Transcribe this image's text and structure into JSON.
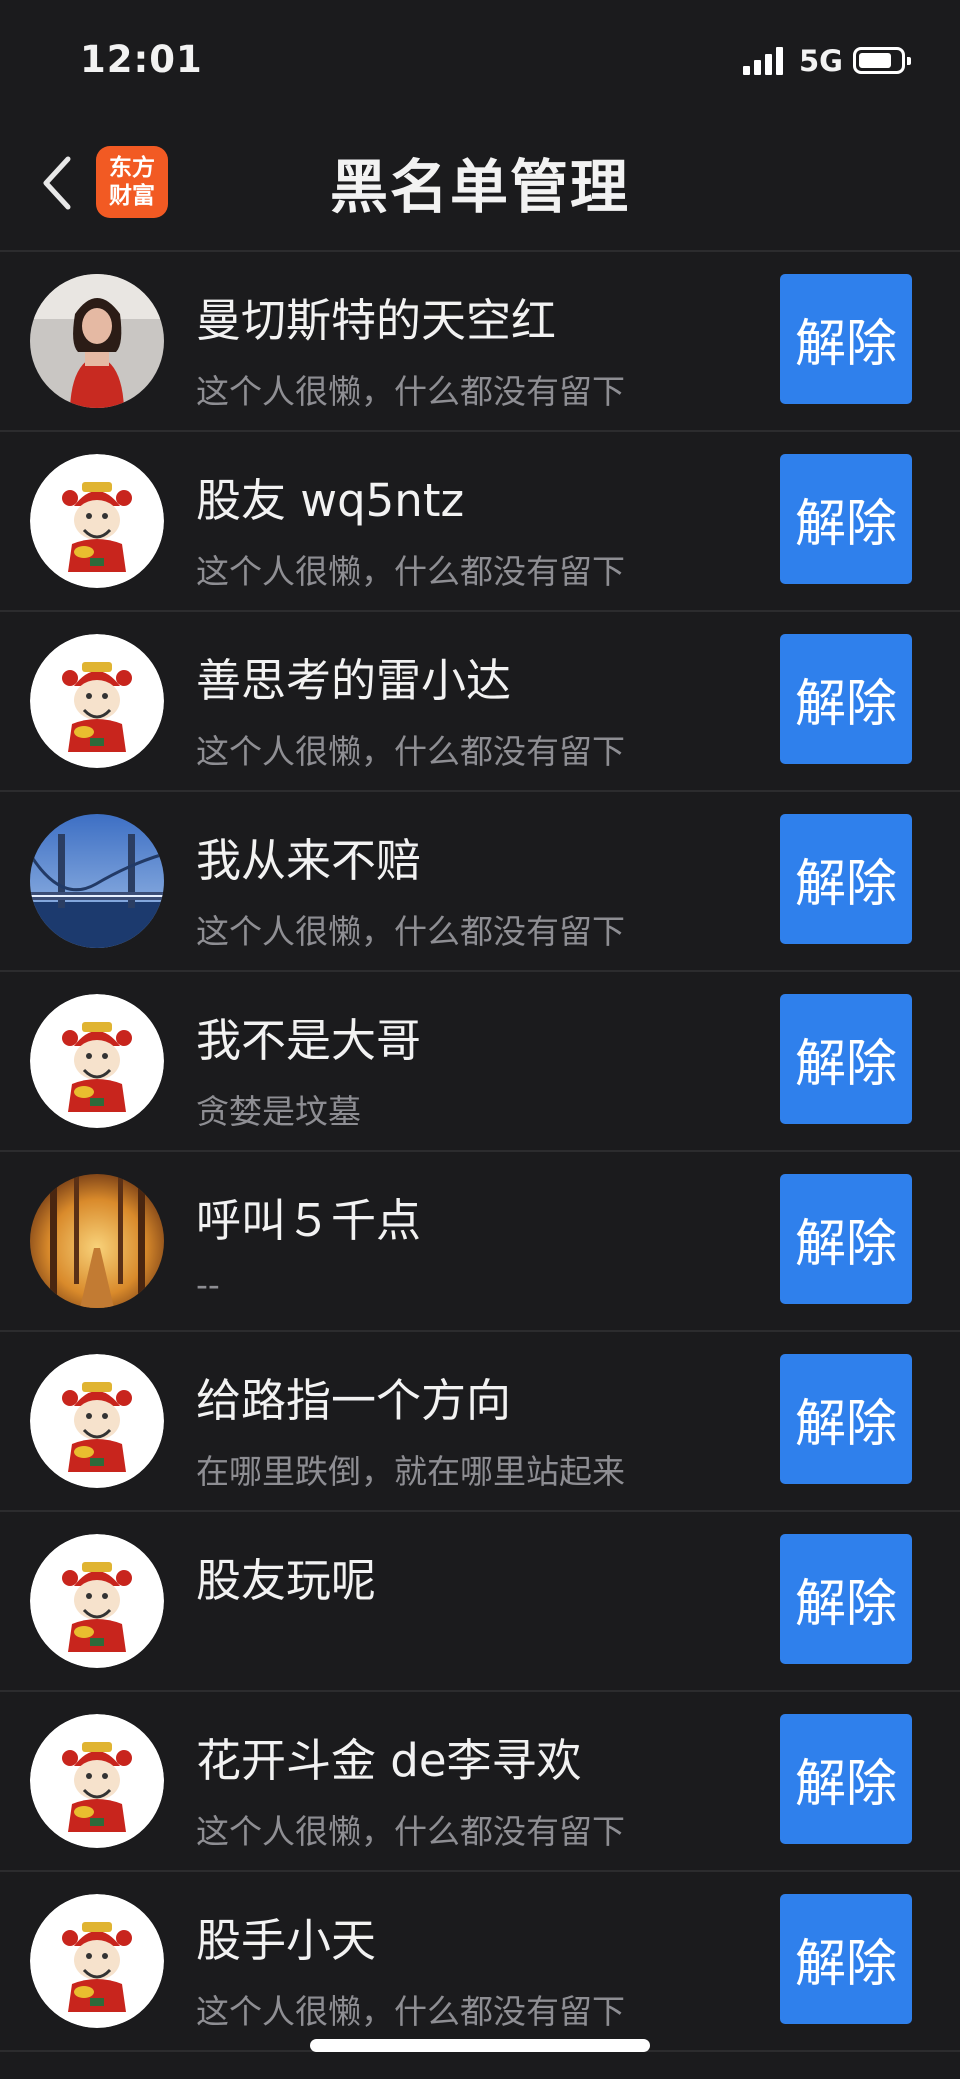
{
  "status_bar": {
    "time": "12:01",
    "network": "5G"
  },
  "header": {
    "title": "黑名单管理",
    "logo_line1": "东方",
    "logo_line2": "财富"
  },
  "users": [
    {
      "name": "曼切斯特的天空红",
      "signature": "这个人很懒，什么都没有留下",
      "avatar": "photo-woman",
      "action": "解除"
    },
    {
      "name": "股友 wq5ntz",
      "signature": "这个人很懒，什么都没有留下",
      "avatar": "god-of-wealth",
      "action": "解除"
    },
    {
      "name": "善思考的雷小达",
      "signature": "这个人很懒，什么都没有留下",
      "avatar": "god-of-wealth",
      "action": "解除"
    },
    {
      "name": "我从来不赔",
      "signature": "这个人很懒，什么都没有留下",
      "avatar": "photo-bridge",
      "action": "解除"
    },
    {
      "name": "我不是大哥",
      "signature": "贪婪是坟墓",
      "avatar": "god-of-wealth",
      "action": "解除"
    },
    {
      "name": "呼叫５千点",
      "signature": "--",
      "avatar": "photo-autumn",
      "action": "解除"
    },
    {
      "name": "给路指一个方向",
      "signature": "在哪里跌倒，就在哪里站起来",
      "avatar": "god-of-wealth",
      "action": "解除"
    },
    {
      "name": "股友玩呢",
      "signature": "",
      "avatar": "god-of-wealth",
      "action": "解除"
    },
    {
      "name": "花开斗金 de李寻欢",
      "signature": "这个人很懒，什么都没有留下",
      "avatar": "god-of-wealth",
      "action": "解除"
    },
    {
      "name": "股手小天",
      "signature": "这个人很懒，什么都没有留下",
      "avatar": "god-of-wealth",
      "action": "解除"
    }
  ]
}
